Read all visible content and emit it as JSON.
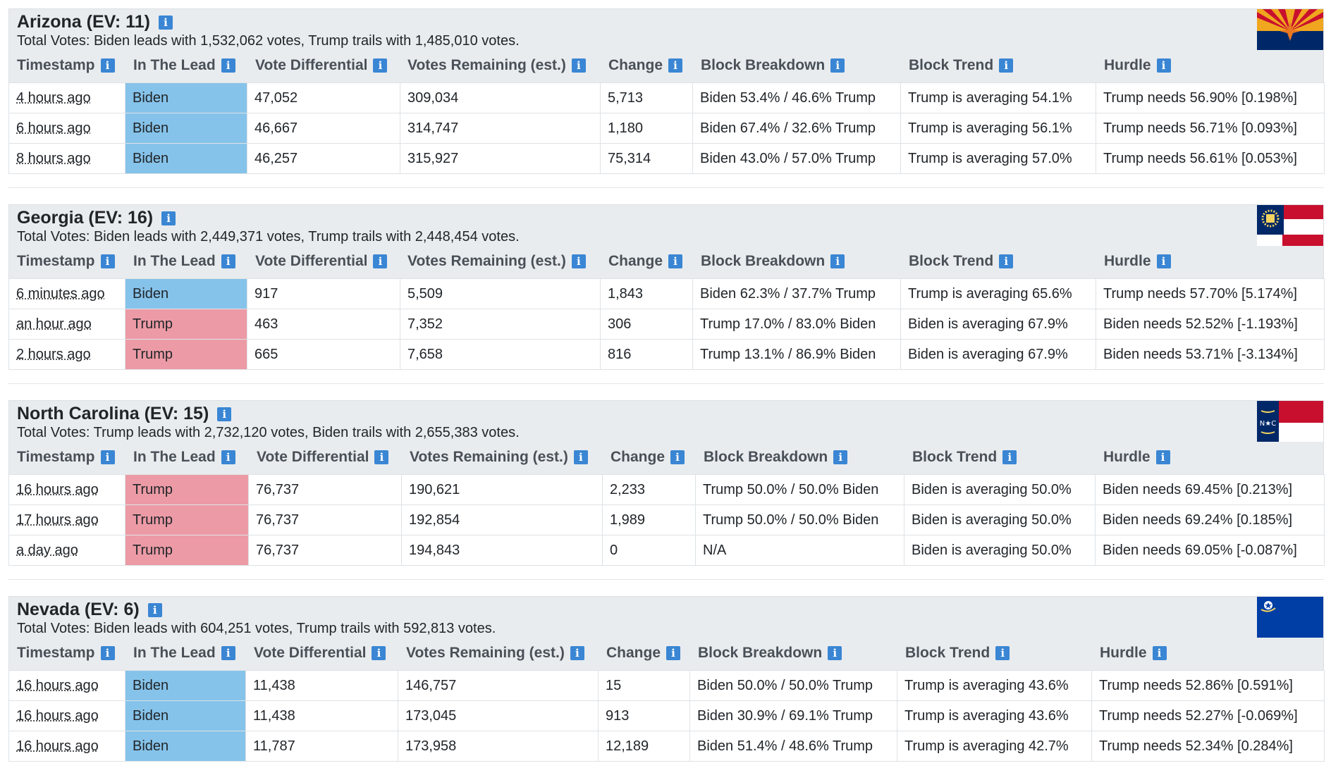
{
  "columns": [
    "Timestamp",
    "In The Lead",
    "Vote Differential",
    "Votes Remaining (est.)",
    "Change",
    "Block Breakdown",
    "Block Trend",
    "Hurdle"
  ],
  "info_glyph": "i",
  "colors": {
    "biden": "#86c3ea",
    "trump": "#ec9ba6",
    "info": "#3a86d4",
    "header_bg": "#e9ecef"
  },
  "states": [
    {
      "title": "Arizona (EV: 11)",
      "total": "Total Votes: Biden leads with 1,532,062 votes, Trump trails with 1,485,010 votes.",
      "flag": "arizona-flag",
      "rows": [
        {
          "ts": "4 hours ago",
          "lead": "Biden",
          "diff": "47,052",
          "remaining": "309,034",
          "change": "5,713",
          "breakdown": "Biden 53.4% / 46.6% Trump",
          "trend": "Trump is averaging 54.1%",
          "hurdle": "Trump needs 56.90% [0.198%]"
        },
        {
          "ts": "6 hours ago",
          "lead": "Biden",
          "diff": "46,667",
          "remaining": "314,747",
          "change": "1,180",
          "breakdown": "Biden 67.4% / 32.6% Trump",
          "trend": "Trump is averaging 56.1%",
          "hurdle": "Trump needs 56.71% [0.093%]"
        },
        {
          "ts": "8 hours ago",
          "lead": "Biden",
          "diff": "46,257",
          "remaining": "315,927",
          "change": "75,314",
          "breakdown": "Biden 43.0% / 57.0% Trump",
          "trend": "Trump is averaging 57.0%",
          "hurdle": "Trump needs 56.61% [0.053%]"
        }
      ]
    },
    {
      "title": "Georgia (EV: 16)",
      "total": "Total Votes: Biden leads with 2,449,371 votes, Trump trails with 2,448,454 votes.",
      "flag": "georgia-flag",
      "rows": [
        {
          "ts": "6 minutes ago",
          "lead": "Biden",
          "diff": "917",
          "remaining": "5,509",
          "change": "1,843",
          "breakdown": "Biden 62.3% / 37.7% Trump",
          "trend": "Trump is averaging 65.6%",
          "hurdle": "Trump needs 57.70% [5.174%]"
        },
        {
          "ts": "an hour ago",
          "lead": "Trump",
          "diff": "463",
          "remaining": "7,352",
          "change": "306",
          "breakdown": "Trump 17.0% / 83.0% Biden",
          "trend": "Biden is averaging 67.9%",
          "hurdle": "Biden needs 52.52% [-1.193%]"
        },
        {
          "ts": "2 hours ago",
          "lead": "Trump",
          "diff": "665",
          "remaining": "7,658",
          "change": "816",
          "breakdown": "Trump 13.1% / 86.9% Biden",
          "trend": "Biden is averaging 67.9%",
          "hurdle": "Biden needs 53.71% [-3.134%]"
        }
      ]
    },
    {
      "title": "North Carolina (EV: 15)",
      "total": "Total Votes: Trump leads with 2,732,120 votes, Biden trails with 2,655,383 votes.",
      "flag": "north-carolina-flag",
      "flag_text": "N★C",
      "rows": [
        {
          "ts": "16 hours ago",
          "lead": "Trump",
          "diff": "76,737",
          "remaining": "190,621",
          "change": "2,233",
          "breakdown": "Trump 50.0% / 50.0% Biden",
          "trend": "Biden is averaging 50.0%",
          "hurdle": "Biden needs 69.45% [0.213%]"
        },
        {
          "ts": "17 hours ago",
          "lead": "Trump",
          "diff": "76,737",
          "remaining": "192,854",
          "change": "1,989",
          "breakdown": "Trump 50.0% / 50.0% Biden",
          "trend": "Biden is averaging 50.0%",
          "hurdle": "Biden needs 69.24% [0.185%]"
        },
        {
          "ts": "a day ago",
          "lead": "Trump",
          "diff": "76,737",
          "remaining": "194,843",
          "change": "0",
          "breakdown": "N/A",
          "trend": "Biden is averaging 50.0%",
          "hurdle": "Biden needs 69.05% [-0.087%]"
        }
      ]
    },
    {
      "title": "Nevada (EV: 6)",
      "total": "Total Votes: Biden leads with 604,251 votes, Trump trails with 592,813 votes.",
      "flag": "nevada-flag",
      "rows": [
        {
          "ts": "16 hours ago",
          "lead": "Biden",
          "diff": "11,438",
          "remaining": "146,757",
          "change": "15",
          "breakdown": "Biden 50.0% / 50.0% Trump",
          "trend": "Trump is averaging 43.6%",
          "hurdle": "Trump needs 52.86% [0.591%]"
        },
        {
          "ts": "16 hours ago",
          "lead": "Biden",
          "diff": "11,438",
          "remaining": "173,045",
          "change": "913",
          "breakdown": "Biden 30.9% / 69.1% Trump",
          "trend": "Trump is averaging 43.6%",
          "hurdle": "Trump needs 52.27% [-0.069%]"
        },
        {
          "ts": "16 hours ago",
          "lead": "Biden",
          "diff": "11,787",
          "remaining": "173,958",
          "change": "12,189",
          "breakdown": "Biden 51.4% / 48.6% Trump",
          "trend": "Trump is averaging 42.7%",
          "hurdle": "Trump needs 52.34% [0.284%]"
        }
      ]
    }
  ]
}
